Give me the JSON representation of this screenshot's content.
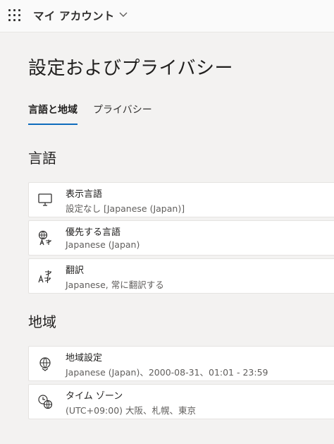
{
  "header": {
    "app_title": "マイ アカウント"
  },
  "page": {
    "title": "設定およびプライバシー"
  },
  "tabs": [
    {
      "label": "言語と地域",
      "active": true
    },
    {
      "label": "プライバシー",
      "active": false
    }
  ],
  "sections": {
    "language": {
      "heading": "言語",
      "items": [
        {
          "icon": "monitor-icon",
          "title": "表示言語",
          "value": "設定なし [Japanese (Japan)]"
        },
        {
          "icon": "preferred-language-icon",
          "title": "優先する言語",
          "value": "Japanese (Japan)"
        },
        {
          "icon": "translate-icon",
          "title": "翻訳",
          "value": "Japanese, 常に翻訳する"
        }
      ]
    },
    "region": {
      "heading": "地域",
      "items": [
        {
          "icon": "region-globe-icon",
          "title": "地域設定",
          "value": "Japanese (Japan)、2000-08-31、01:01 - 23:59"
        },
        {
          "icon": "time-zone-icon",
          "title": "タイム ゾーン",
          "value": "(UTC+09:00) 大阪、札幌、東京"
        }
      ]
    }
  },
  "colors": {
    "background": "#f3f2f1",
    "card": "#ffffff",
    "accent": "#0f6cbd",
    "secondary_text": "#605e5c"
  }
}
